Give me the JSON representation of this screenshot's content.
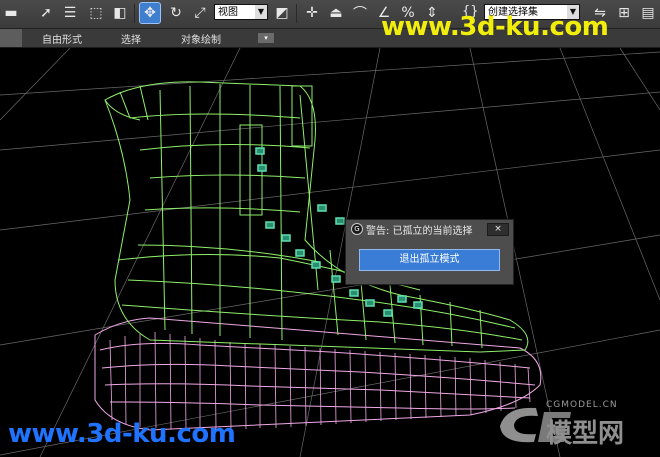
{
  "toolbar": {
    "view_dropdown": "视图",
    "selection_set_dropdown": "创建选择集"
  },
  "ribbon": {
    "tabs": [
      "自由形式",
      "选择",
      "对象绘制"
    ]
  },
  "dialog": {
    "title": "警告: 已孤立的当前选择",
    "close_label": "×",
    "exit_button": "退出孤立模式"
  },
  "watermarks": {
    "top": "www.3d-ku.com",
    "bottom": "www.3d-ku.com",
    "logo_sub": "CGMODEL.CN",
    "logo_main": "模型网"
  },
  "colors": {
    "upper_wire": "#8ff06a",
    "sole_wire": "#f0a8e6",
    "grid": "#8c8c8c",
    "button_accent": "#3a7dd6"
  }
}
